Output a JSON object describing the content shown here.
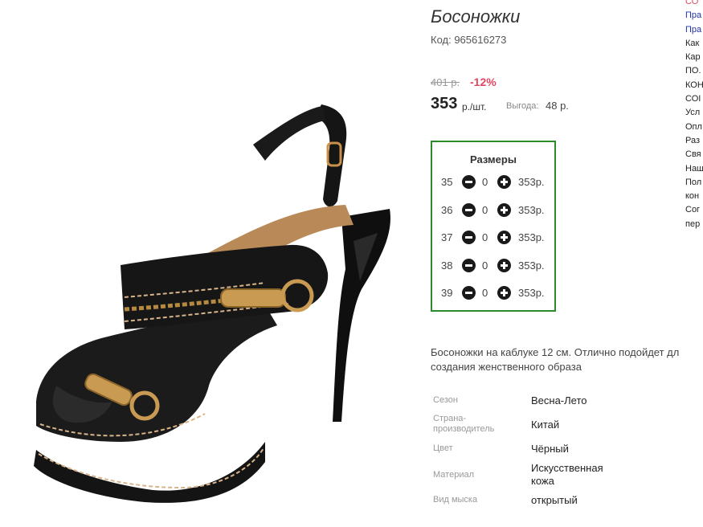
{
  "product": {
    "title": "Босоножки",
    "code": "Код: 965616273",
    "old_price": "401 р.",
    "discount": "-12%",
    "price": "353",
    "price_unit": "р./шт.",
    "benefit_label": "Выгода:",
    "benefit_value": "48 р."
  },
  "sizes": {
    "title": "Размеры",
    "rows": [
      {
        "size": "35",
        "qty": "0",
        "price": "353р."
      },
      {
        "size": "36",
        "qty": "0",
        "price": "353р."
      },
      {
        "size": "37",
        "qty": "0",
        "price": "353р."
      },
      {
        "size": "38",
        "qty": "0",
        "price": "353р."
      },
      {
        "size": "39",
        "qty": "0",
        "price": "353р."
      }
    ]
  },
  "description": [
    "Босоножки на каблуке 12 см. Отлично подойдет дл",
    "создания женственного образа"
  ],
  "attributes": [
    {
      "label": [
        "Сезон"
      ],
      "value": [
        "Весна-Лето"
      ]
    },
    {
      "label": [
        "Страна-",
        "производитель"
      ],
      "value": [
        "Китай"
      ]
    },
    {
      "label": [
        "Цвет"
      ],
      "value": [
        "Чёрный"
      ]
    },
    {
      "label": [
        "Материал"
      ],
      "value": [
        "Искусственная",
        "кожа"
      ]
    },
    {
      "label": [
        "Вид мыска"
      ],
      "value": [
        "открытый"
      ]
    }
  ],
  "side_links": [
    {
      "text": "СО",
      "color": "#e2455f"
    },
    {
      "text": "Пра",
      "color": "#2233aa"
    },
    {
      "text": "Пра",
      "color": "#2233aa"
    },
    {
      "text": "Как",
      "color": "#222222"
    },
    {
      "text": "Кар",
      "color": "#222222"
    },
    {
      "text": "ПО.",
      "color": "#222222"
    },
    {
      "text": "КОН",
      "color": "#222222"
    },
    {
      "text": "СОІ",
      "color": "#222222"
    },
    {
      "text": "Усл",
      "color": "#222222"
    },
    {
      "text": "Опл",
      "color": "#222222"
    },
    {
      "text": "Раз",
      "color": "#222222"
    },
    {
      "text": "Свя",
      "color": "#222222"
    },
    {
      "text": "Наш",
      "color": "#222222"
    },
    {
      "text": "Пол",
      "color": "#222222"
    },
    {
      "text": "кон",
      "color": "#222222"
    },
    {
      "text": "Сог",
      "color": "#222222"
    },
    {
      "text": "пер",
      "color": "#222222"
    }
  ],
  "colors": {
    "accent_discount": "#e2455f",
    "sizes_border": "#2b8a2b",
    "link": "#2233aa"
  },
  "icons": {
    "minus": "minus-circle-icon",
    "plus": "plus-circle-icon"
  }
}
